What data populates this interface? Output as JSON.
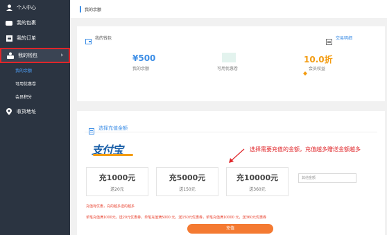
{
  "sidebar": {
    "items": [
      {
        "label": "个人中心",
        "icon": "user-icon"
      },
      {
        "label": "我的包裹",
        "icon": "package-icon"
      },
      {
        "label": "我的订单",
        "icon": "order-icon"
      },
      {
        "label": "我的钱包",
        "icon": "wallet-icon"
      },
      {
        "label": "收货地址",
        "icon": "location-icon"
      }
    ],
    "sub_items": [
      {
        "label": "我的余额"
      },
      {
        "label": "可用优惠卷"
      },
      {
        "label": "会员积分"
      }
    ]
  },
  "header": {
    "title": "我的余额"
  },
  "wallet": {
    "title": "我的钱包",
    "transactions_link": "交易明细",
    "balance_value": "¥500",
    "balance_label": "我的余额",
    "coupon_label": "可用优惠卷",
    "discount_value": "10.0折",
    "discount_label": "会员权益"
  },
  "recharge": {
    "title": "选择充值金额",
    "logo_text": "支付宝",
    "options": [
      {
        "amount": "充1000元",
        "gift": "送20元"
      },
      {
        "amount": "充5000元",
        "gift": "送150元"
      },
      {
        "amount": "充10000元",
        "gift": "送360元"
      }
    ],
    "other_placeholder": "其他金额",
    "note1": "充值有优惠，充的越多送的越多",
    "note2": "单笔充值满1000元，送20元优惠券，单笔充值满5000 元，送150元优惠券，单笔充值满10000 元，送360元优惠券",
    "pay_button": "充值"
  },
  "annotation": {
    "text": "选择需要充值的金额，充值越多赠送金额越多"
  },
  "colors": {
    "accent": "#3d8ee6",
    "orange": "#f39c12",
    "red": "#e0262a",
    "button": "#f47a32",
    "sidebar": "#2b3441"
  }
}
